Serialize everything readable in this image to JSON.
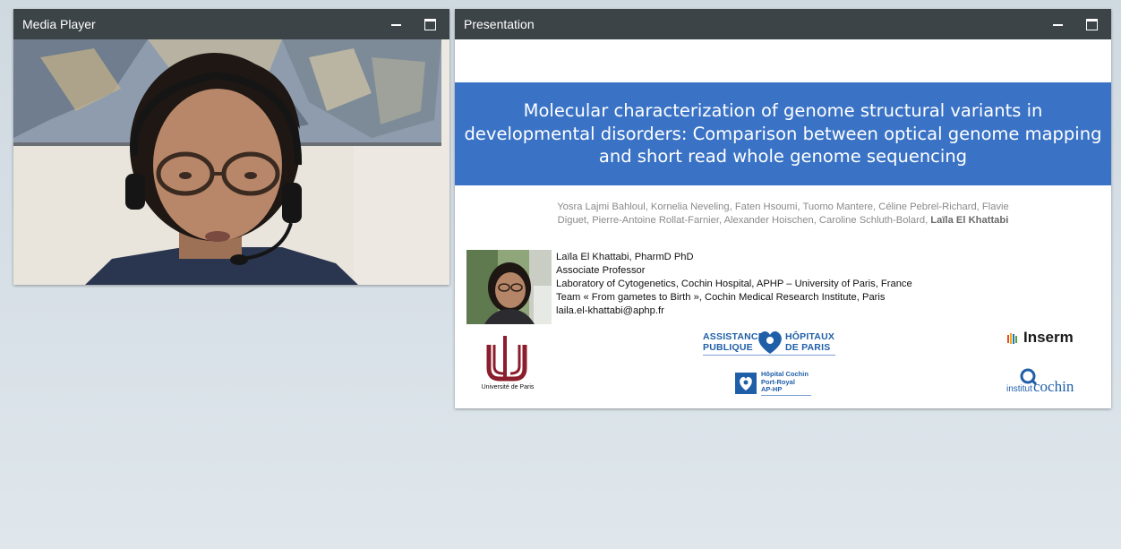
{
  "media_player": {
    "title": "Media Player"
  },
  "presentation": {
    "title": "Presentation",
    "slide": {
      "title": "Molecular characterization of genome structural variants in developmental disorders: Comparison between optical genome mapping and short read whole genome sequencing",
      "authors_line1": "Yosra Lajmi Bahloul, Kornelia Neveling, Faten Hsoumi, Tuomo Mantere, Céline Pebrel-Richard, Flavie",
      "authors_line2": "Diguet, Pierre-Antoine Rollat-Farnier, Alexander Hoischen, Caroline Schluth-Bolard,",
      "authors_highlight": "Laïla El Khattabi",
      "contact": {
        "name": "Laïla El Khattabi, PharmD PhD",
        "position": "Associate Professor",
        "lab": "Laboratory of Cytogenetics, Cochin Hospital, APHP – University of Paris, France",
        "team": "Team « From gametes to Birth », Cochin Medical Research Institute, Paris",
        "email": "laila.el-khattabi@aphp.fr"
      },
      "logos": {
        "aphp_line1_left": "ASSISTANCE",
        "aphp_line1_right": "HÔPITAUX",
        "aphp_line2_left": "PUBLIQUE",
        "aphp_line2_right": "DE PARIS",
        "inserm": "Inserm",
        "universite": "Université de Paris",
        "cochin_hospital_line1": "Hôpital Cochin",
        "cochin_hospital_line2": "Port-Royal",
        "cochin_hospital_line3": "AP-HP",
        "institut_left": "institut",
        "institut_right": "cochin"
      }
    }
  },
  "colors": {
    "header_bg": "#3c4448",
    "title_band": "#3a73c6",
    "aphp_blue": "#1f5fa8",
    "universite_red": "#8b1d2c"
  },
  "icons": {
    "minimize": "minimize-icon",
    "maximize": "maximize-icon"
  }
}
